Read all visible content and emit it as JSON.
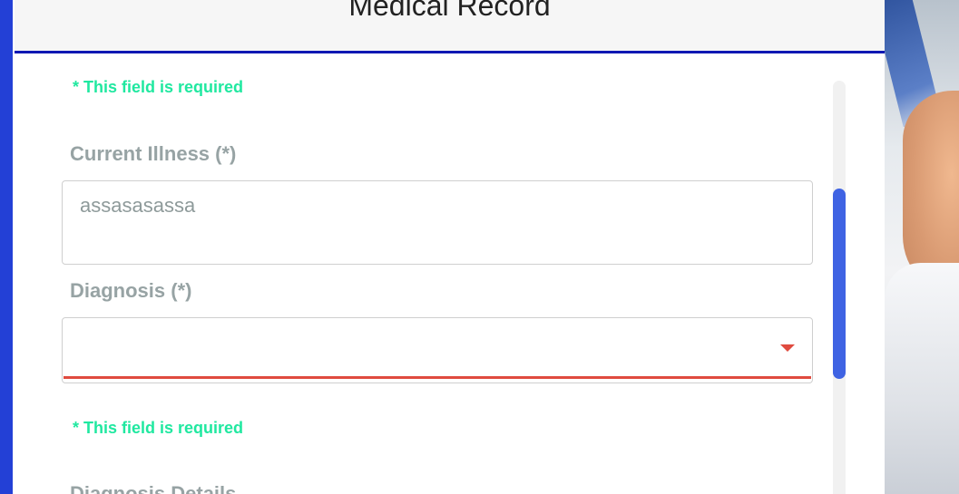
{
  "modal": {
    "title": "Medical Record"
  },
  "form": {
    "top_error": "* This field is required",
    "current_illness": {
      "label": "Current Illness (*)",
      "value": "assasasassa"
    },
    "diagnosis": {
      "label": "Diagnosis (*)",
      "value": "",
      "error": "* This field is required"
    },
    "diagnosis_details": {
      "label": "Diagnosis Details"
    }
  },
  "colors": {
    "accent": "#2340d6",
    "header_rule": "#0d18b3",
    "error_text": "#20e8a0",
    "invalid_underline": "#e04b3f",
    "scroll_thumb": "#3f63e3"
  },
  "icons": {
    "select_caret": "caret-down-icon"
  }
}
